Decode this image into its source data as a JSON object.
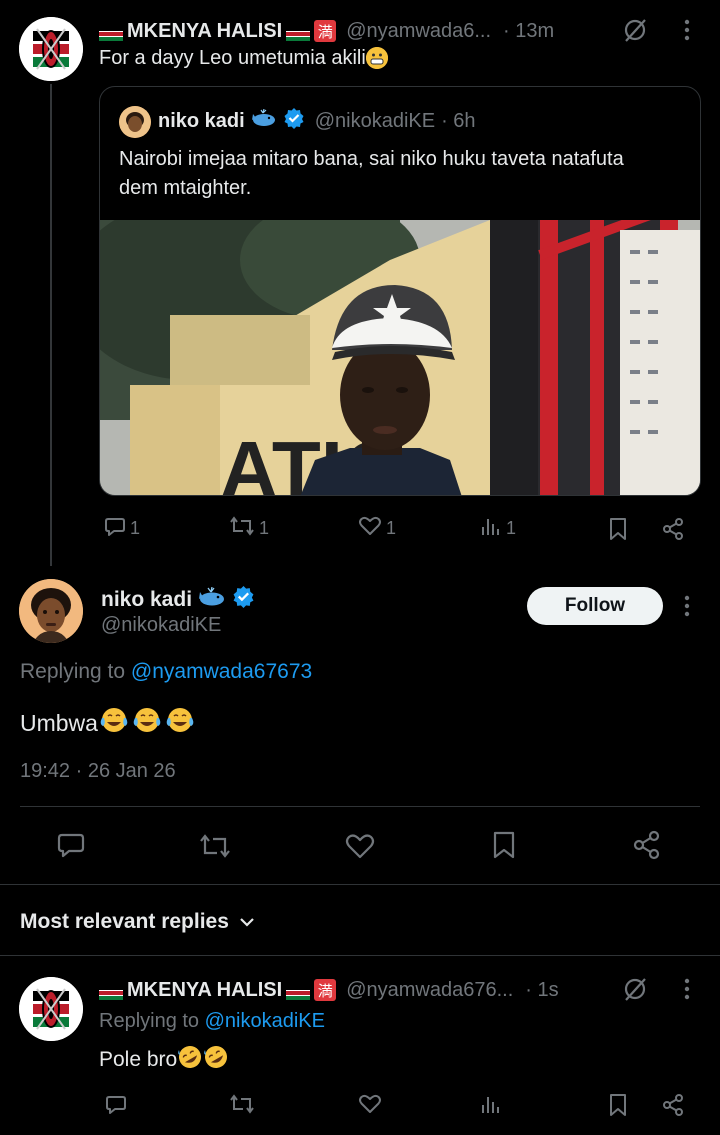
{
  "colors": {
    "background": "#000000",
    "accent": "#1d9bf0",
    "muted": "#71767b",
    "text": "#e7e9ea",
    "divider": "#2f3336"
  },
  "top_post": {
    "display_name": "MKENYA HALISI",
    "badge": "満",
    "handle": "@nyamwada6...",
    "time": "· 13m",
    "text": "For a dayy Leo umetumia akili",
    "quote": {
      "display_name": "niko kadi",
      "handle": "@nikokadiKE",
      "time": "· 6h",
      "text": "Nairobi imejaa mitaro bana, sai niko huku taveta natafuta dem mtaighter.",
      "image_sign_text": "ATIO"
    },
    "actions": {
      "replies": "1",
      "reposts": "1",
      "likes": "1",
      "views": "1"
    }
  },
  "main_post": {
    "display_name": "niko kadi",
    "handle": "@nikokadiKE",
    "follow_label": "Follow",
    "replying_prefix": "Replying to",
    "replying_handle": "@nyamwada67673",
    "text": "Umbwa",
    "timestamp": "19:42 · 26 Jan 26"
  },
  "replies_header": {
    "label": "Most relevant replies"
  },
  "reply": {
    "display_name": "MKENYA HALISI",
    "badge": "満",
    "handle": "@nyamwada676...",
    "time": "· 1s",
    "replying_prefix": "Replying to",
    "replying_handle": "@nikokadiKE",
    "text": "Pole bro"
  }
}
